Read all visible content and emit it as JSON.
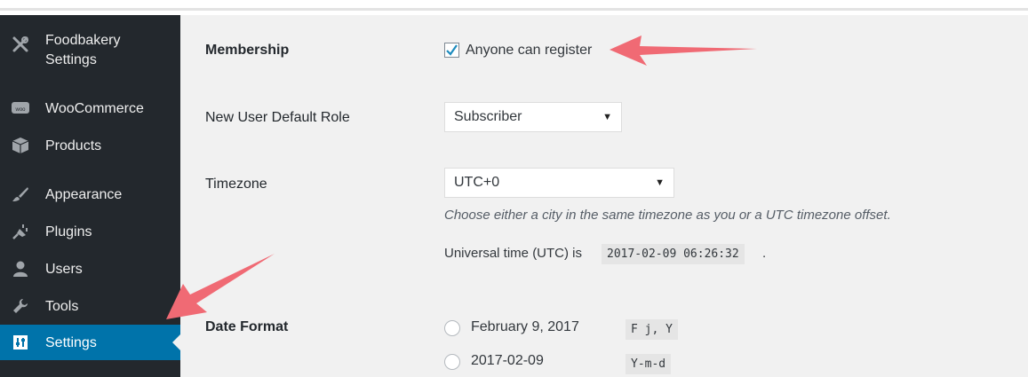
{
  "colors": {
    "sidebar_bg": "#23282d",
    "active_bg": "#0073aa",
    "content_bg": "#f1f1f1",
    "annotation_arrow": "#f06a74"
  },
  "sidebar": {
    "items": [
      {
        "label": "Foodbakery",
        "label2": "Settings",
        "icon": "tools-cross-icon"
      },
      {
        "label": "WooCommerce",
        "icon": "woocommerce-icon"
      },
      {
        "label": "Products",
        "icon": "box-icon"
      },
      {
        "label": "Appearance",
        "icon": "paint-brush-icon"
      },
      {
        "label": "Plugins",
        "icon": "plug-icon"
      },
      {
        "label": "Users",
        "icon": "user-icon"
      },
      {
        "label": "Tools",
        "icon": "wrench-icon"
      },
      {
        "label": "Settings",
        "icon": "settings-sliders-icon",
        "active": true
      }
    ]
  },
  "settings": {
    "membership": {
      "label": "Membership",
      "checkbox_label": "Anyone can register",
      "checked": true
    },
    "default_role": {
      "label": "New User Default Role",
      "value": "Subscriber"
    },
    "timezone": {
      "label": "Timezone",
      "value": "UTC+0",
      "description": "Choose either a city in the same timezone as you or a UTC timezone offset.",
      "utc_prefix": "Universal time (UTC) is",
      "utc_time": "2017-02-09 06:26:32",
      "utc_suffix": "."
    },
    "date_format": {
      "label": "Date Format",
      "options": [
        {
          "text": "February 9, 2017",
          "code": "F j, Y"
        },
        {
          "text": "2017-02-09",
          "code": "Y-m-d"
        }
      ]
    }
  }
}
